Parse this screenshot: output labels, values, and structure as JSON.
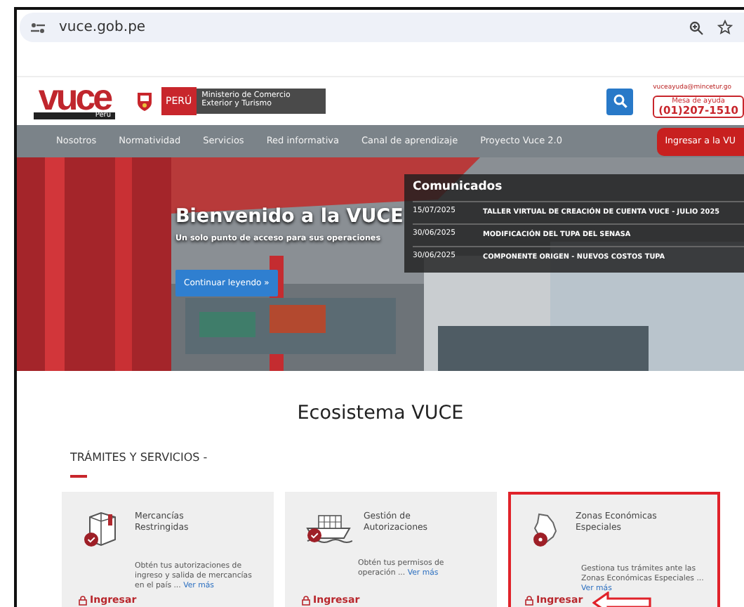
{
  "browser": {
    "url": "vuce.gob.pe"
  },
  "header": {
    "logo_text": "vuce",
    "logo_sub": "Perú",
    "peru_badge": "PERÚ",
    "ministry": "Ministerio de Comercio Exterior y Turismo",
    "email": "vuceayuda@mincetur.go",
    "help_label": "Mesa de ayuda",
    "help_phone": "(01)207-1510"
  },
  "nav": {
    "items": [
      "Nosotros",
      "Normatividad",
      "Servicios",
      "Red informativa",
      "Canal de aprendizaje",
      "Proyecto Vuce 2.0"
    ],
    "login_button": "Ingresar a la VU"
  },
  "hero": {
    "title": "Bienvenido a la VUCE",
    "subtitle": "Un solo punto de acceso para sus operaciones",
    "button": "Continuar leyendo »"
  },
  "communiques": {
    "title": "Comunicados",
    "items": [
      {
        "date": "15/07/2025",
        "text": "TALLER VIRTUAL DE CREACIÓN DE CUENTA VUCE - JULIO 2025"
      },
      {
        "date": "30/06/2025",
        "text": "MODIFICACIÓN DEL TUPA DEL SENASA"
      },
      {
        "date": "30/06/2025",
        "text": "COMPONENTE ORIGEN - NUEVOS COSTOS TUPA"
      }
    ]
  },
  "ecosystem": {
    "title": "Ecosistema VUCE",
    "section": "TRÁMITES Y SERVICIOS -"
  },
  "cards": [
    {
      "kind": "box",
      "title": "Mercancías Restringidas",
      "description": "Obtén tus autorizaciones de ingreso y salida de mercancías en el país ...",
      "link": "Ver más",
      "action": "Ingresar",
      "highlighted": false,
      "arrow": false
    },
    {
      "kind": "ship",
      "title": "Gestión de Autorizaciones",
      "description": "Obtén tus permisos de operación ...",
      "link": "Ver más",
      "action": "Ingresar",
      "highlighted": false,
      "arrow": false
    },
    {
      "kind": "map",
      "title": "Zonas Económicas Especiales",
      "description": "Gestiona tus trámites ante las Zonas Económicas Especiales ...",
      "link": "Ver más",
      "action": "Ingresar",
      "highlighted": true,
      "arrow": true
    }
  ]
}
